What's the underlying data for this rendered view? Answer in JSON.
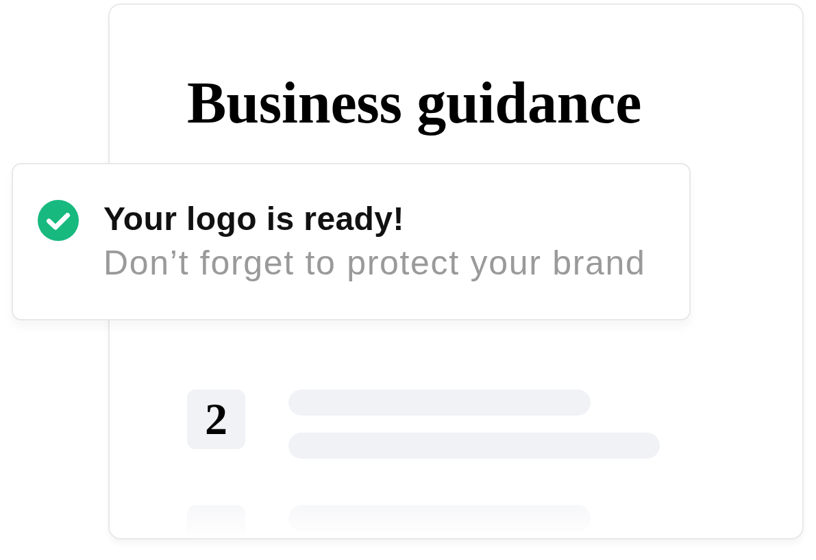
{
  "card": {
    "title": "Business guidance",
    "steps": [
      {
        "number": "2",
        "faded": false
      },
      {
        "faded": true
      }
    ]
  },
  "toast": {
    "title": "Your logo is ready!",
    "message": "Don’t forget to protect your brand"
  }
}
